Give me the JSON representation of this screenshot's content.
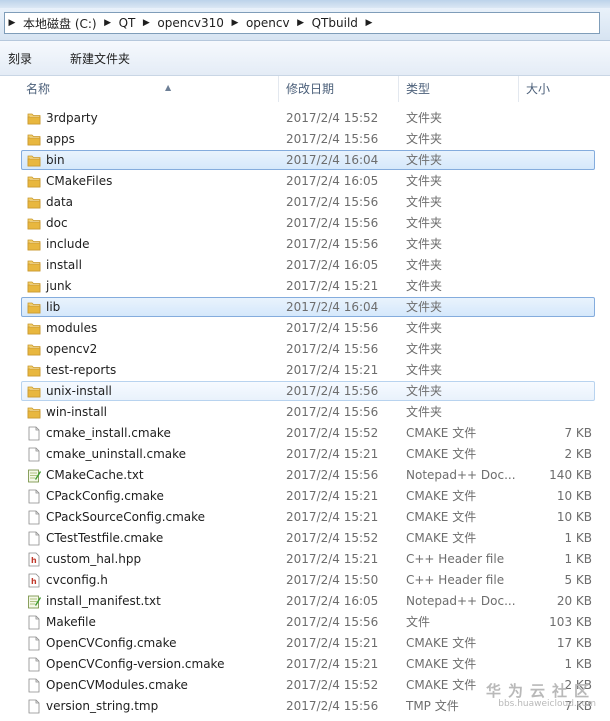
{
  "address": {
    "crumbs": [
      "本地磁盘 (C:)",
      "QT",
      "opencv310",
      "opencv",
      "QTbuild"
    ]
  },
  "toolbar": {
    "burn_label": "刻录",
    "new_folder_label": "新建文件夹"
  },
  "columns": {
    "name": "名称",
    "date": "修改日期",
    "type": "类型",
    "size": "大小"
  },
  "files": [
    {
      "name": "3rdparty",
      "date": "2017/2/4 15:52",
      "type": "文件夹",
      "size": "",
      "kind": "folder",
      "state": ""
    },
    {
      "name": "apps",
      "date": "2017/2/4 15:56",
      "type": "文件夹",
      "size": "",
      "kind": "folder",
      "state": ""
    },
    {
      "name": "bin",
      "date": "2017/2/4 16:04",
      "type": "文件夹",
      "size": "",
      "kind": "folder",
      "state": "selected"
    },
    {
      "name": "CMakeFiles",
      "date": "2017/2/4 16:05",
      "type": "文件夹",
      "size": "",
      "kind": "folder",
      "state": ""
    },
    {
      "name": "data",
      "date": "2017/2/4 15:56",
      "type": "文件夹",
      "size": "",
      "kind": "folder",
      "state": ""
    },
    {
      "name": "doc",
      "date": "2017/2/4 15:56",
      "type": "文件夹",
      "size": "",
      "kind": "folder",
      "state": ""
    },
    {
      "name": "include",
      "date": "2017/2/4 15:56",
      "type": "文件夹",
      "size": "",
      "kind": "folder",
      "state": ""
    },
    {
      "name": "install",
      "date": "2017/2/4 16:05",
      "type": "文件夹",
      "size": "",
      "kind": "folder",
      "state": ""
    },
    {
      "name": "junk",
      "date": "2017/2/4 15:21",
      "type": "文件夹",
      "size": "",
      "kind": "folder",
      "state": ""
    },
    {
      "name": "lib",
      "date": "2017/2/4 16:04",
      "type": "文件夹",
      "size": "",
      "kind": "folder",
      "state": "selected"
    },
    {
      "name": "modules",
      "date": "2017/2/4 15:56",
      "type": "文件夹",
      "size": "",
      "kind": "folder",
      "state": ""
    },
    {
      "name": "opencv2",
      "date": "2017/2/4 15:56",
      "type": "文件夹",
      "size": "",
      "kind": "folder",
      "state": ""
    },
    {
      "name": "test-reports",
      "date": "2017/2/4 15:21",
      "type": "文件夹",
      "size": "",
      "kind": "folder",
      "state": ""
    },
    {
      "name": "unix-install",
      "date": "2017/2/4 15:56",
      "type": "文件夹",
      "size": "",
      "kind": "folder",
      "state": "hover"
    },
    {
      "name": "win-install",
      "date": "2017/2/4 15:56",
      "type": "文件夹",
      "size": "",
      "kind": "folder",
      "state": ""
    },
    {
      "name": "cmake_install.cmake",
      "date": "2017/2/4 15:52",
      "type": "CMAKE 文件",
      "size": "7 KB",
      "kind": "file",
      "state": ""
    },
    {
      "name": "cmake_uninstall.cmake",
      "date": "2017/2/4 15:21",
      "type": "CMAKE 文件",
      "size": "2 KB",
      "kind": "file",
      "state": ""
    },
    {
      "name": "CMakeCache.txt",
      "date": "2017/2/4 15:56",
      "type": "Notepad++ Doc...",
      "size": "140 KB",
      "kind": "notepad",
      "state": ""
    },
    {
      "name": "CPackConfig.cmake",
      "date": "2017/2/4 15:21",
      "type": "CMAKE 文件",
      "size": "10 KB",
      "kind": "file",
      "state": ""
    },
    {
      "name": "CPackSourceConfig.cmake",
      "date": "2017/2/4 15:21",
      "type": "CMAKE 文件",
      "size": "10 KB",
      "kind": "file",
      "state": ""
    },
    {
      "name": "CTestTestfile.cmake",
      "date": "2017/2/4 15:52",
      "type": "CMAKE 文件",
      "size": "1 KB",
      "kind": "file",
      "state": ""
    },
    {
      "name": "custom_hal.hpp",
      "date": "2017/2/4 15:21",
      "type": "C++ Header file",
      "size": "1 KB",
      "kind": "header",
      "state": ""
    },
    {
      "name": "cvconfig.h",
      "date": "2017/2/4 15:50",
      "type": "C++ Header file",
      "size": "5 KB",
      "kind": "header",
      "state": ""
    },
    {
      "name": "install_manifest.txt",
      "date": "2017/2/4 16:05",
      "type": "Notepad++ Doc...",
      "size": "20 KB",
      "kind": "notepad",
      "state": ""
    },
    {
      "name": "Makefile",
      "date": "2017/2/4 15:56",
      "type": "文件",
      "size": "103 KB",
      "kind": "file",
      "state": ""
    },
    {
      "name": "OpenCVConfig.cmake",
      "date": "2017/2/4 15:21",
      "type": "CMAKE 文件",
      "size": "17 KB",
      "kind": "file",
      "state": ""
    },
    {
      "name": "OpenCVConfig-version.cmake",
      "date": "2017/2/4 15:21",
      "type": "CMAKE 文件",
      "size": "1 KB",
      "kind": "file",
      "state": ""
    },
    {
      "name": "OpenCVModules.cmake",
      "date": "2017/2/4 15:52",
      "type": "CMAKE 文件",
      "size": "2 KB",
      "kind": "file",
      "state": ""
    },
    {
      "name": "version_string.tmp",
      "date": "2017/2/4 15:56",
      "type": "TMP 文件",
      "size": "7 KB",
      "kind": "file",
      "state": ""
    }
  ],
  "watermark": {
    "cn": "华为云社区",
    "en": "bbs.huaweicloud.com"
  },
  "colors": {
    "folder": "#e8b73f",
    "selected_border": "#84acdd",
    "header_text": "#4c607a"
  }
}
